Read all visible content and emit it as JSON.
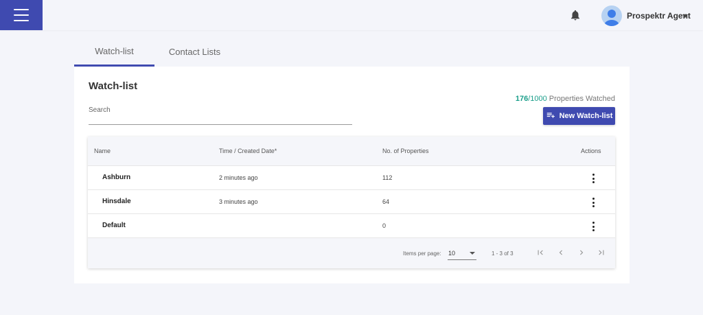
{
  "header": {
    "user_name": "Prospektr Agent"
  },
  "tabs": [
    {
      "label": "Watch-list",
      "active": true
    },
    {
      "label": "Contact Lists",
      "active": false
    }
  ],
  "card": {
    "title": "Watch-list",
    "search": {
      "label": "Search",
      "value": ""
    },
    "watched": {
      "count": "176",
      "max": "/1000",
      "suffix": " Properties Watched"
    },
    "new_button": "New Watch-list"
  },
  "table": {
    "columns": [
      "Name",
      "Time / Created Date*",
      "No. of Properties",
      "Actions"
    ],
    "rows": [
      {
        "name": "Ashburn",
        "created": "2 minutes ago",
        "properties": "112"
      },
      {
        "name": "Hinsdale",
        "created": "3 minutes ago",
        "properties": "64"
      },
      {
        "name": "Default",
        "created": "",
        "properties": "0"
      }
    ]
  },
  "paginator": {
    "items_per_page_label": "Items per page:",
    "items_per_page": "10",
    "range": "1 - 3 of 3"
  },
  "colors": {
    "primary": "#3f4ab0",
    "accent": "#1a9e8a",
    "background": "#f4f5fa"
  },
  "icons": [
    "menu-icon",
    "bell-icon",
    "avatar-icon",
    "caret-down-icon",
    "playlist-add-icon",
    "more-vert-icon",
    "first-page-icon",
    "chevron-left-icon",
    "chevron-right-icon",
    "last-page-icon"
  ]
}
